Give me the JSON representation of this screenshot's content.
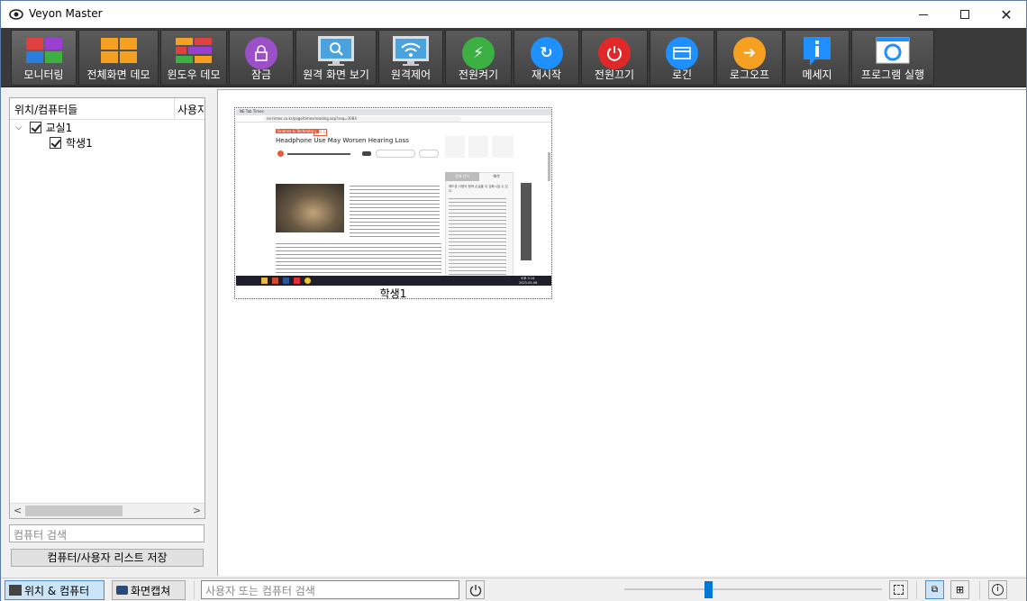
{
  "window": {
    "title": "Veyon Master"
  },
  "toolbar": {
    "buttons": [
      {
        "label": "모니터링",
        "icon": "monitoring-icon"
      },
      {
        "label": "전체화면 데모",
        "icon": "fullscreen-demo-icon"
      },
      {
        "label": "윈도우 데모",
        "icon": "window-demo-icon"
      },
      {
        "label": "잠금",
        "icon": "lock-icon"
      },
      {
        "label": "원격 화면 보기",
        "icon": "remote-view-icon"
      },
      {
        "label": "원격제어",
        "icon": "remote-control-icon"
      },
      {
        "label": "전원켜기",
        "icon": "power-on-icon"
      },
      {
        "label": "재시작",
        "icon": "reboot-icon"
      },
      {
        "label": "전원끄기",
        "icon": "power-off-icon"
      },
      {
        "label": "로긴",
        "icon": "login-icon"
      },
      {
        "label": "로그오프",
        "icon": "logoff-icon"
      },
      {
        "label": "메세지",
        "icon": "message-icon"
      },
      {
        "label": "프로그램 실행",
        "icon": "run-program-icon"
      }
    ]
  },
  "left_panel": {
    "col_location": "위치/컴퓨터들",
    "col_user": "사용자",
    "tree": {
      "room": "교실1",
      "computer": "학생1"
    },
    "search_placeholder": "컴퓨터 검색",
    "save_button": "컴퓨터/사용자 리스트 저장"
  },
  "main": {
    "computer_label": "학생1",
    "screen_preview": {
      "tab": "NE Tab Times",
      "url": "ne.times.co.kr/page/times/reading.asp?seq=3084",
      "category": "Science & Technology",
      "badge": "중학 1",
      "headline": "Headphone Use May Worsen Hearing Loss",
      "side_tab1": "전체 단어",
      "side_tab2": "해석",
      "side_caption": "헤드폰 사용이 청력 손실을 더 심화시킬 수 있다",
      "taskbar_time": "오후 3:14",
      "taskbar_date": "2023-05-06"
    }
  },
  "bottom": {
    "btn_locations": "위치 & 컴퓨터",
    "btn_screenshots": "화면캡쳐",
    "search_placeholder": "사용자 또는 컴퓨터 검색",
    "zoom_percent": 32
  },
  "colors": {
    "toolbar_bg": "#3a3a3a",
    "accent": "#0078d7"
  }
}
